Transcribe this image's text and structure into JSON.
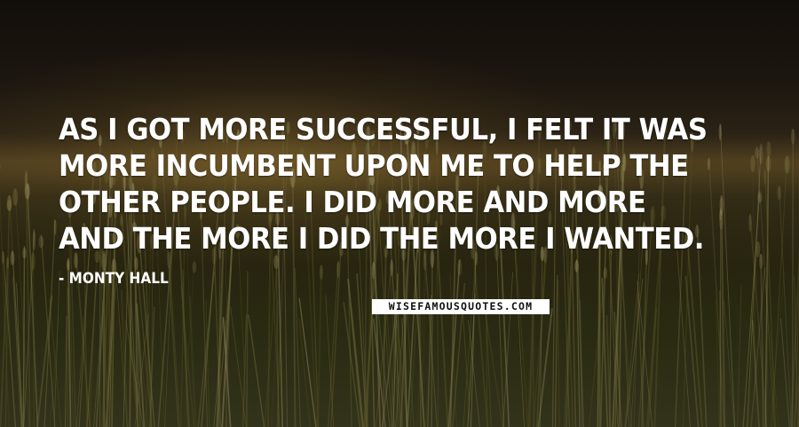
{
  "quote": {
    "text": "As I got more successful, I felt it was more incumbent upon me to help the other people. I did more and more and the more I did the more I wanted.",
    "author": "- Monty Hall"
  },
  "watermark": {
    "text": "WISEFAMOUSQUOTES.COM"
  },
  "colors": {
    "text": "#ffffff",
    "sky_dark": "#120e0a",
    "horizon_glow": "#3a3019",
    "field": "#2a2a12"
  }
}
